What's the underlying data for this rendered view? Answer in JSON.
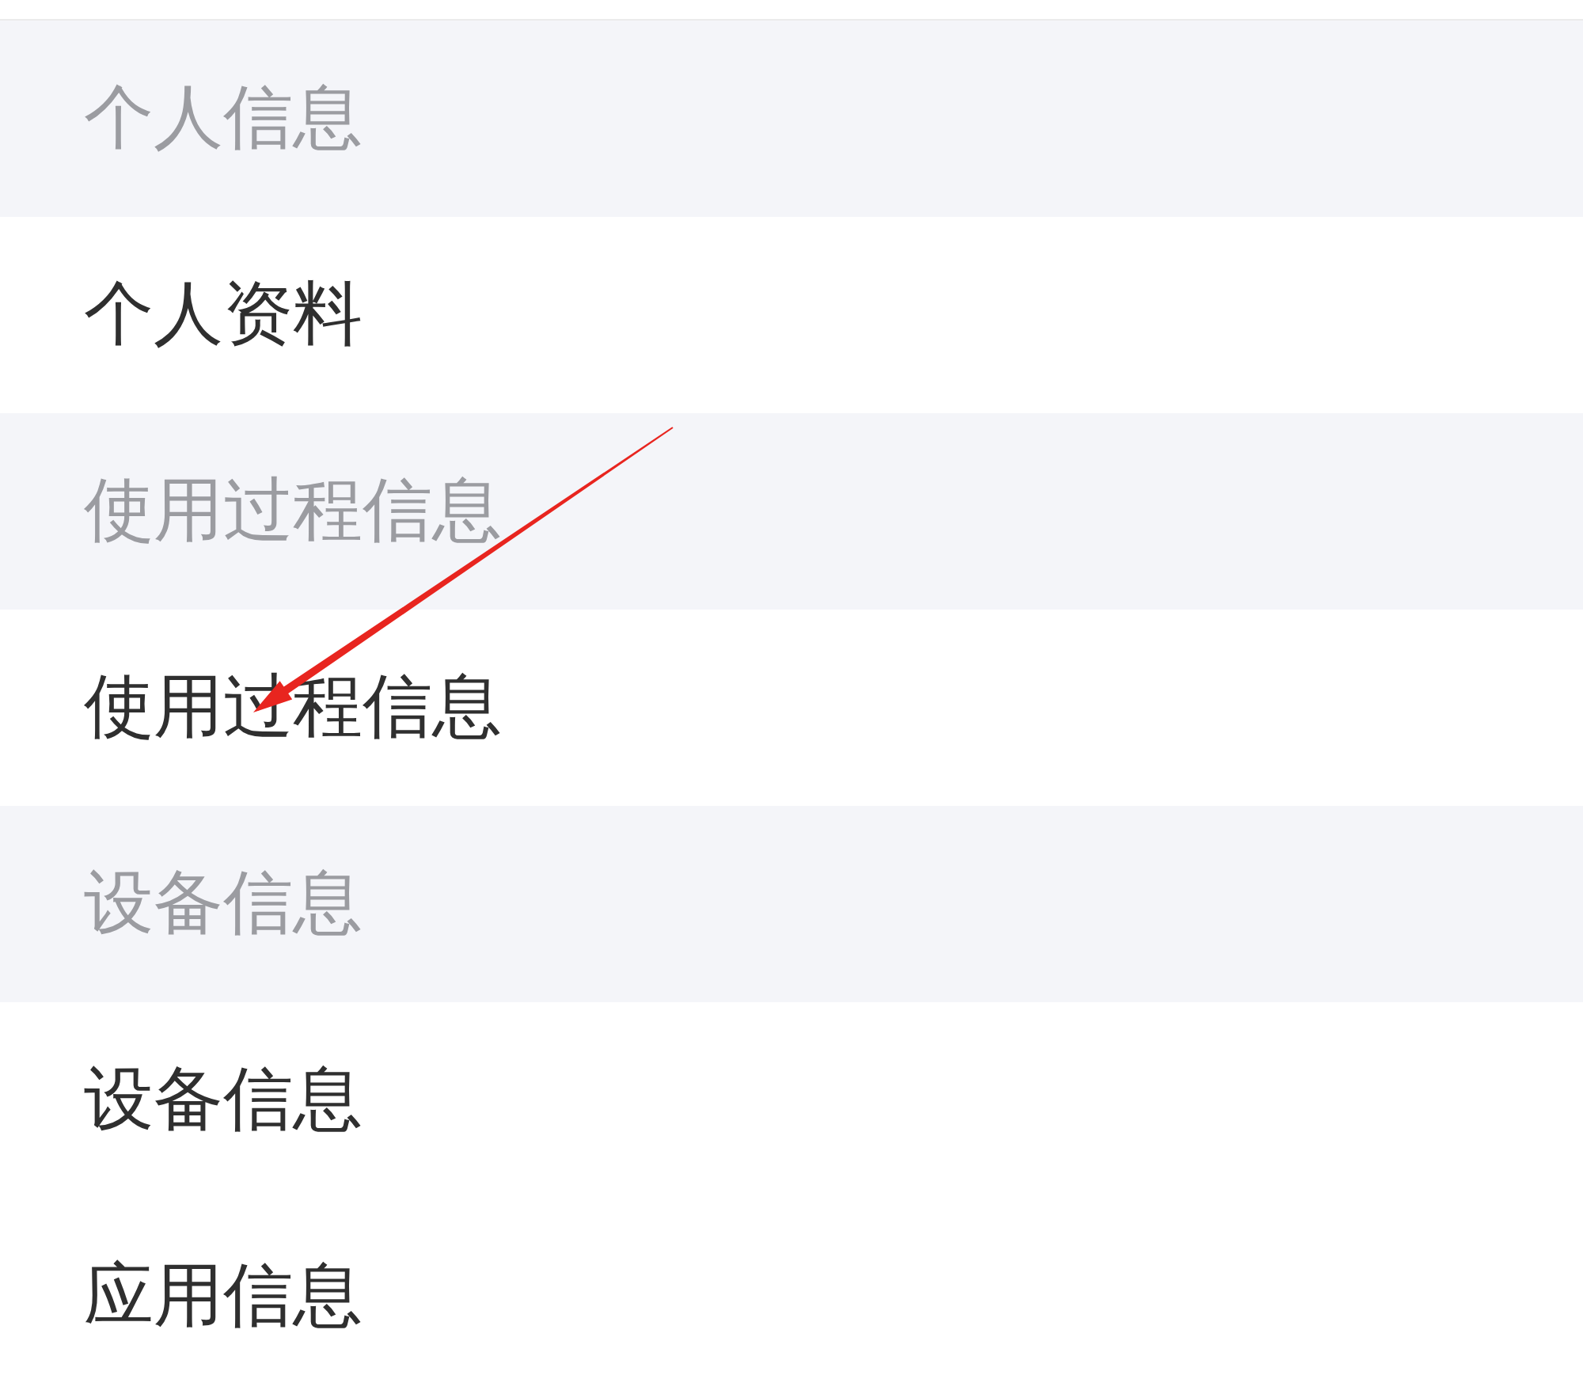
{
  "sections": [
    {
      "title": "个人信息",
      "items": [
        {
          "label": "个人资料"
        }
      ]
    },
    {
      "title": "使用过程信息",
      "items": [
        {
          "label": "使用过程信息"
        }
      ]
    },
    {
      "title": "设备信息",
      "items": [
        {
          "label": "设备信息"
        },
        {
          "label": "应用信息"
        }
      ]
    }
  ]
}
